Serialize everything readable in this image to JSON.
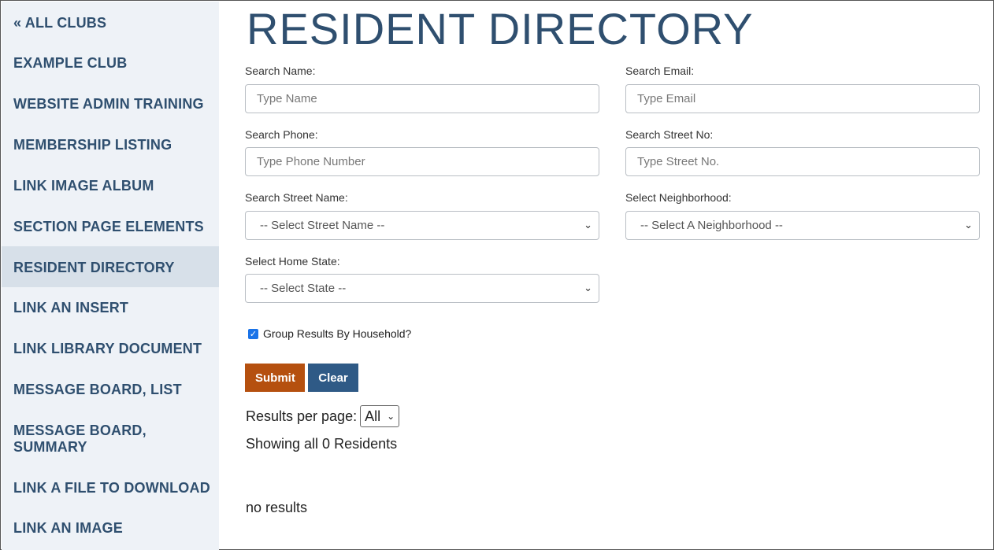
{
  "sidebar": {
    "items": [
      {
        "label": "« ALL CLUBS"
      },
      {
        "label": "EXAMPLE CLUB"
      },
      {
        "label": "WEBSITE ADMIN TRAINING"
      },
      {
        "label": "MEMBERSHIP LISTING"
      },
      {
        "label": "LINK IMAGE ALBUM"
      },
      {
        "label": "SECTION PAGE ELEMENTS"
      },
      {
        "label": "RESIDENT DIRECTORY",
        "active": true
      },
      {
        "label": "LINK AN INSERT"
      },
      {
        "label": "LINK LIBRARY DOCUMENT"
      },
      {
        "label": "MESSAGE BOARD, LIST"
      },
      {
        "label": "MESSAGE BOARD, SUMMARY"
      },
      {
        "label": "LINK A FILE TO DOWNLOAD"
      },
      {
        "label": "LINK AN IMAGE"
      }
    ]
  },
  "main": {
    "title": "RESIDENT DIRECTORY",
    "search_name": {
      "label": "Search Name:",
      "placeholder": "Type Name",
      "value": ""
    },
    "search_email": {
      "label": "Search Email:",
      "placeholder": "Type Email",
      "value": ""
    },
    "search_phone": {
      "label": "Search Phone:",
      "placeholder": "Type Phone Number",
      "value": ""
    },
    "search_street_no": {
      "label": "Search Street No:",
      "placeholder": "Type Street No.",
      "value": ""
    },
    "search_street_name": {
      "label": "Search Street Name:",
      "selected": "-- Select Street Name --"
    },
    "select_neighborhood": {
      "label": "Select Neighborhood:",
      "selected": "-- Select A Neighborhood --"
    },
    "select_home_state": {
      "label": "Select Home State:",
      "selected": "-- Select State --"
    },
    "group_by_household": {
      "label": "Group Results By Household?",
      "checked": true
    },
    "submit_label": "Submit",
    "clear_label": "Clear",
    "results_per_page": {
      "label": "Results per page:",
      "selected": "All"
    },
    "showing_text": "Showing all 0 Residents",
    "no_results_text": "no results"
  },
  "colors": {
    "sidebar_bg": "#eef2f7",
    "sidebar_active_bg": "#d7e0e9",
    "nav_text": "#2f4f6f",
    "submit_bg": "#b5500f",
    "clear_bg": "#2f5a86"
  }
}
